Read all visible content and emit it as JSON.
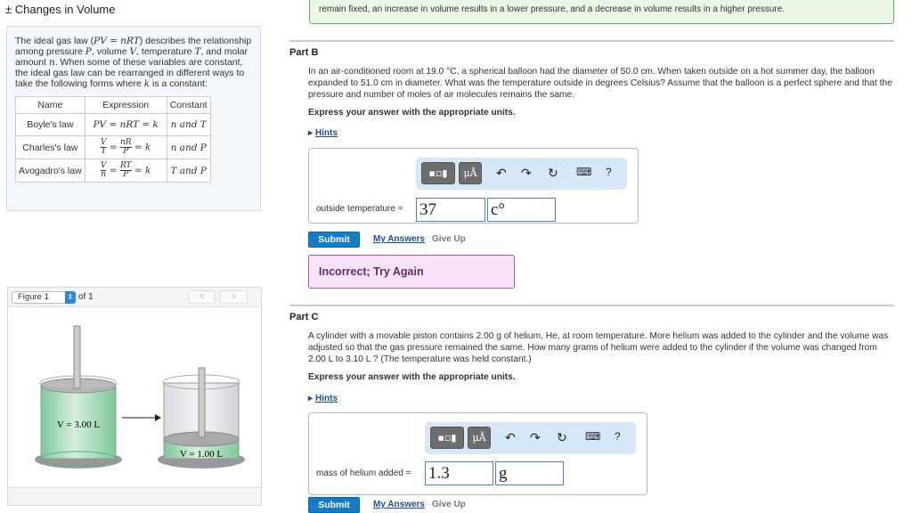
{
  "header": {
    "title": "± Changes in Volume"
  },
  "intro": {
    "text_parts": [
      "The ideal gas law (",
      "PV = nRT",
      ") describes the relationship among pressure ",
      "P",
      ", volume ",
      "V",
      ", temperature ",
      "T",
      ", and molar amount ",
      "n",
      ". When some of these variables are constant, the ideal gas law can be rearranged in different ways to take the following forms where ",
      "k",
      " is a constant:"
    ],
    "table": {
      "headers": [
        "Name",
        "Expression",
        "Constant"
      ],
      "rows": [
        {
          "name": "Boyle's law",
          "expression": "PV = nRT = k",
          "constant": "n and T"
        },
        {
          "name": "Charles's law",
          "num1": "V",
          "den1": "T",
          "num2": "nR",
          "den2": "P",
          "tail": "= k",
          "constant": "n and P"
        },
        {
          "name": "Avogadro's law",
          "num1": "V",
          "den1": "n",
          "num2": "RT",
          "den2": "P",
          "tail": "= k",
          "constant": "T and P"
        }
      ]
    }
  },
  "figure": {
    "selected": "Figure 1",
    "of_label": "of 1",
    "prev": "<",
    "next": ">",
    "label_left": "V = 3.00 L",
    "label_right": "V = 1.00 L"
  },
  "feedback": {
    "text": "remain fixed, an increase in volume results in a lower pressure, and a decrease in volume results in a higher pressure."
  },
  "part_b": {
    "title": "Part B",
    "question": "In an air-conditioned room at 19.0 °C, a spherical balloon had the diameter of 50.0 cm. When taken outside on a hot summer day, the balloon expanded to 51.0 cm in diameter. What was the temperature outside in degrees Celsius? Assume that the balloon is a perfect sphere and that the pressure and number of moles of air molecules remains the same.",
    "express": "Express your answer with the appropriate units.",
    "hints": "Hints",
    "answer_label": "outside temperature =",
    "value": "37",
    "unit": "c°",
    "submit": "Submit",
    "my_answers": "My Answers",
    "give_up": "Give Up",
    "result": "Incorrect; Try Again"
  },
  "part_c": {
    "title": "Part C",
    "question": "A cylinder with a movable piston contains 2.00 g of helium, He, at room temperature. More helium was added to the cylinder and the volume was adjusted so that the gas pressure remained the same. How many grams of helium were added to the cylinder if the volume was changed from 2.00 L to 3.10 L ? (The temperature was held constant.)",
    "express": "Express your answer with the appropriate units.",
    "hints": "Hints",
    "answer_label": "mass of helium added =",
    "value": "1.3",
    "unit": "g",
    "submit": "Submit",
    "my_answers": "My Answers",
    "give_up": "Give Up"
  },
  "toolbar": {
    "units_button": "μÅ",
    "help": "?"
  }
}
